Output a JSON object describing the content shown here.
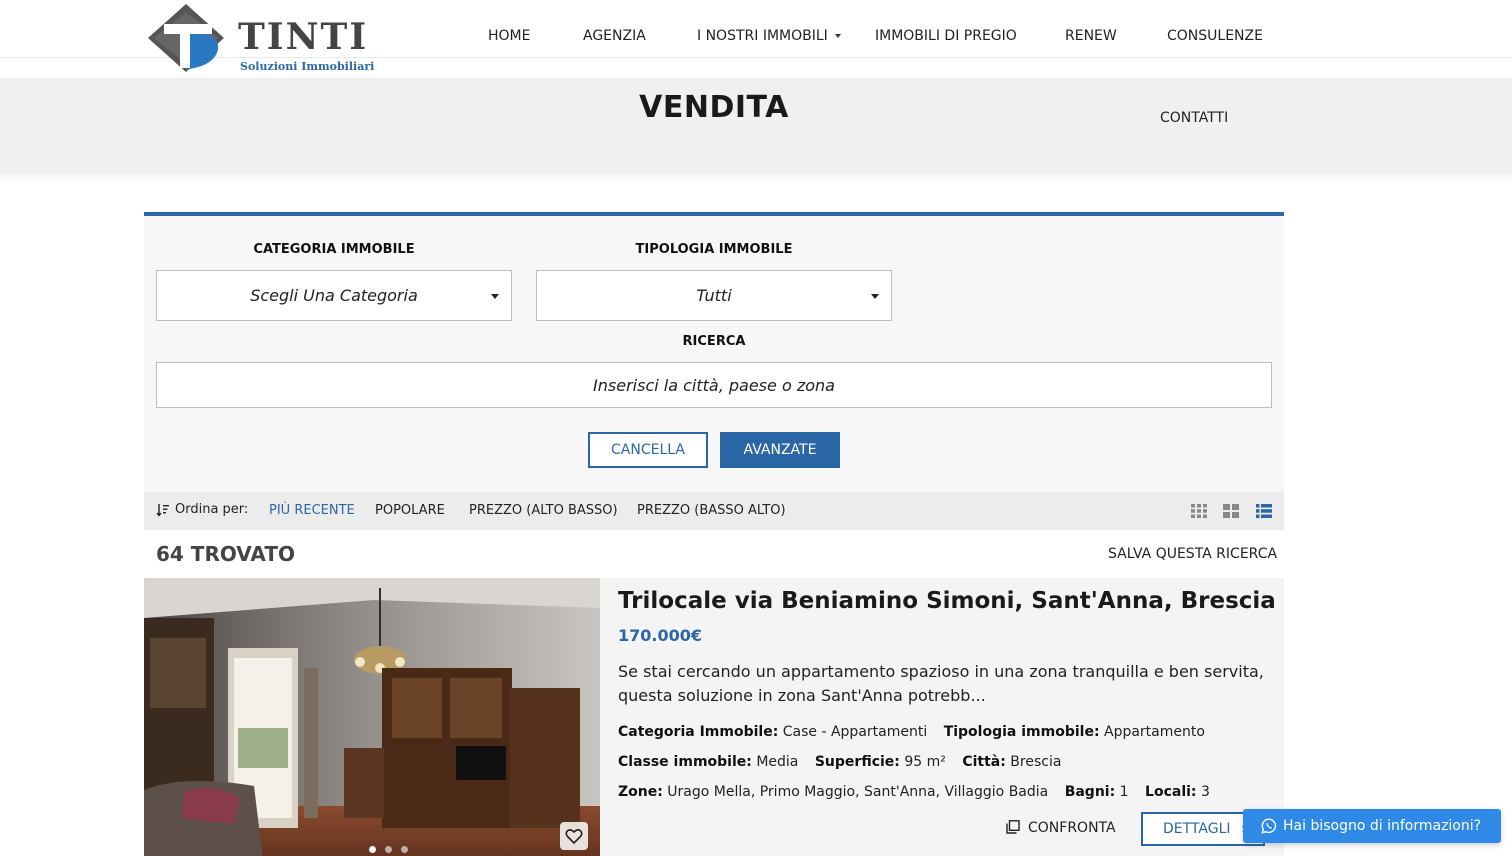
{
  "brand": {
    "name": "TINTI",
    "tagline": "Soluzioni Immobiliari",
    "colors": {
      "primary": "#2b67a6",
      "logo_gray": "#555555",
      "chat": "#2e8ae6"
    }
  },
  "nav": {
    "items": [
      {
        "label": "HOME"
      },
      {
        "label": "AGENZIA"
      },
      {
        "label": "I NOSTRI IMMOBILI",
        "has_dropdown": true
      },
      {
        "label": "IMMOBILI DI PREGIO"
      },
      {
        "label": "RENEW"
      },
      {
        "label": "CONSULENZE"
      }
    ],
    "contatti": "CONTATTI"
  },
  "page": {
    "title": "VENDITA"
  },
  "search": {
    "categoria_label": "CATEGORIA IMMOBILE",
    "categoria_value": "Scegli Una Categoria",
    "tipologia_label": "TIPOLOGIA IMMOBILE",
    "tipologia_value": "Tutti",
    "ricerca_label": "RICERCA",
    "ricerca_placeholder": "Inserisci la città, paese o zona",
    "cancel_label": "CANCELLA",
    "advanced_label": "AVANZATE"
  },
  "sort": {
    "label": "Ordina per:",
    "options": [
      {
        "label": "PIÙ RECENTE",
        "active": true
      },
      {
        "label": "POPOLARE"
      },
      {
        "label": "PREZZO (ALTO BASSO)"
      },
      {
        "label": "PREZZO (BASSO ALTO)"
      }
    ],
    "views": [
      "grid-3-icon",
      "grid-2-icon",
      "list-icon"
    ],
    "active_view": "list-icon"
  },
  "results": {
    "count_text": "64 TROVATO",
    "save_search": "SALVA QUESTA RICERCA"
  },
  "listing": {
    "title": "Trilocale via Beniamino Simoni, Sant'Anna, Brescia",
    "price": "170.000€",
    "description": "Se stai cercando un appartamento spazioso in una zona tranquilla e ben servita, questa soluzione in zona Sant'Anna potrebb...",
    "meta": {
      "categoria_k": "Categoria Immobile:",
      "categoria_v": "Case - Appartamenti",
      "tipologia_k": "Tipologia immobile:",
      "tipologia_v": "Appartamento",
      "classe_k": "Classe immobile:",
      "classe_v": "Media",
      "superficie_k": "Superficie:",
      "superficie_v": "95 m²",
      "citta_k": "Città:",
      "citta_v": "Brescia",
      "zone_k": "Zone:",
      "zone_v": "Urago Mella, Primo Maggio, Sant'Anna, Villaggio Badia",
      "bagni_k": "Bagni:",
      "bagni_v": "1",
      "locali_k": "Locali:",
      "locali_v": "3"
    },
    "compare_label": "CONFRONTA",
    "details_label": "DETTAGLI",
    "photo_dots": 3,
    "photo_active": 1
  },
  "chat": {
    "label": "Hai bisogno di informazioni?"
  }
}
